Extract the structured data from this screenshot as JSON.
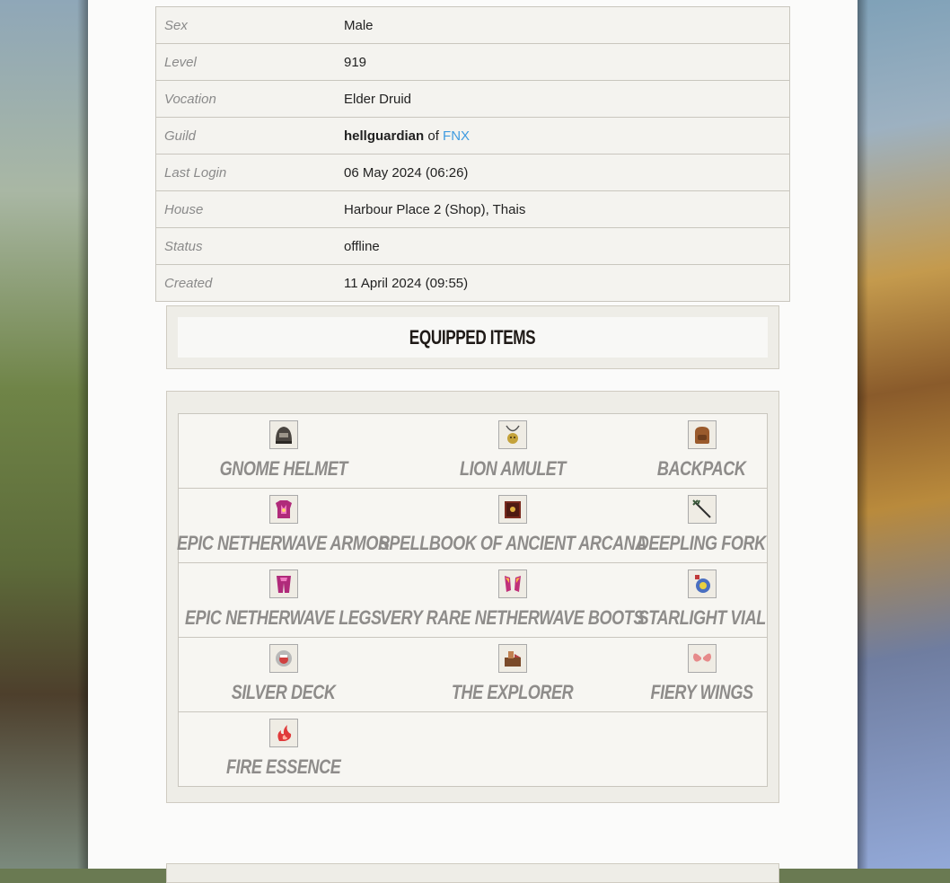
{
  "character": {
    "rows": [
      {
        "label": "Sex",
        "value": "Male"
      },
      {
        "label": "Level",
        "value": "919"
      },
      {
        "label": "Vocation",
        "value": "Elder Druid"
      },
      {
        "label": "Guild",
        "guild_rank": "hellguardian",
        "of": "of",
        "guild_name": "FNX"
      },
      {
        "label": "Last Login",
        "value": "06 May 2024 (06:26)"
      },
      {
        "label": "House",
        "value": "Harbour Place 2 (Shop), Thais"
      },
      {
        "label": "Status",
        "value": "offline"
      },
      {
        "label": "Created",
        "value": "11 April 2024 (09:55)"
      }
    ]
  },
  "equipped": {
    "title": "Equipped Items",
    "items": [
      {
        "name": "Gnome Helmet",
        "icon": "helmet-icon"
      },
      {
        "name": "Lion Amulet",
        "icon": "amulet-icon"
      },
      {
        "name": "Backpack",
        "icon": "backpack-icon"
      },
      {
        "name": "Epic Netherwave Armor",
        "icon": "armor-icon"
      },
      {
        "name": "Spellbook of Ancient Arcana",
        "icon": "spellbook-icon"
      },
      {
        "name": "Deepling Fork",
        "icon": "fork-icon"
      },
      {
        "name": "Epic Netherwave Legs",
        "icon": "legs-icon"
      },
      {
        "name": "Very Rare Netherwave Boots",
        "icon": "boots-icon"
      },
      {
        "name": "Starlight Vial",
        "icon": "vial-icon"
      },
      {
        "name": "Silver Deck",
        "icon": "deck-icon"
      },
      {
        "name": "The Explorer",
        "icon": "explorer-icon"
      },
      {
        "name": "Fiery Wings",
        "icon": "wings-icon"
      },
      {
        "name": "Fire Essence",
        "icon": "essence-icon"
      }
    ]
  },
  "colors": {
    "link": "#3f9be0",
    "panel": "#fbfbfa",
    "item_text": "#8e8c8a"
  }
}
